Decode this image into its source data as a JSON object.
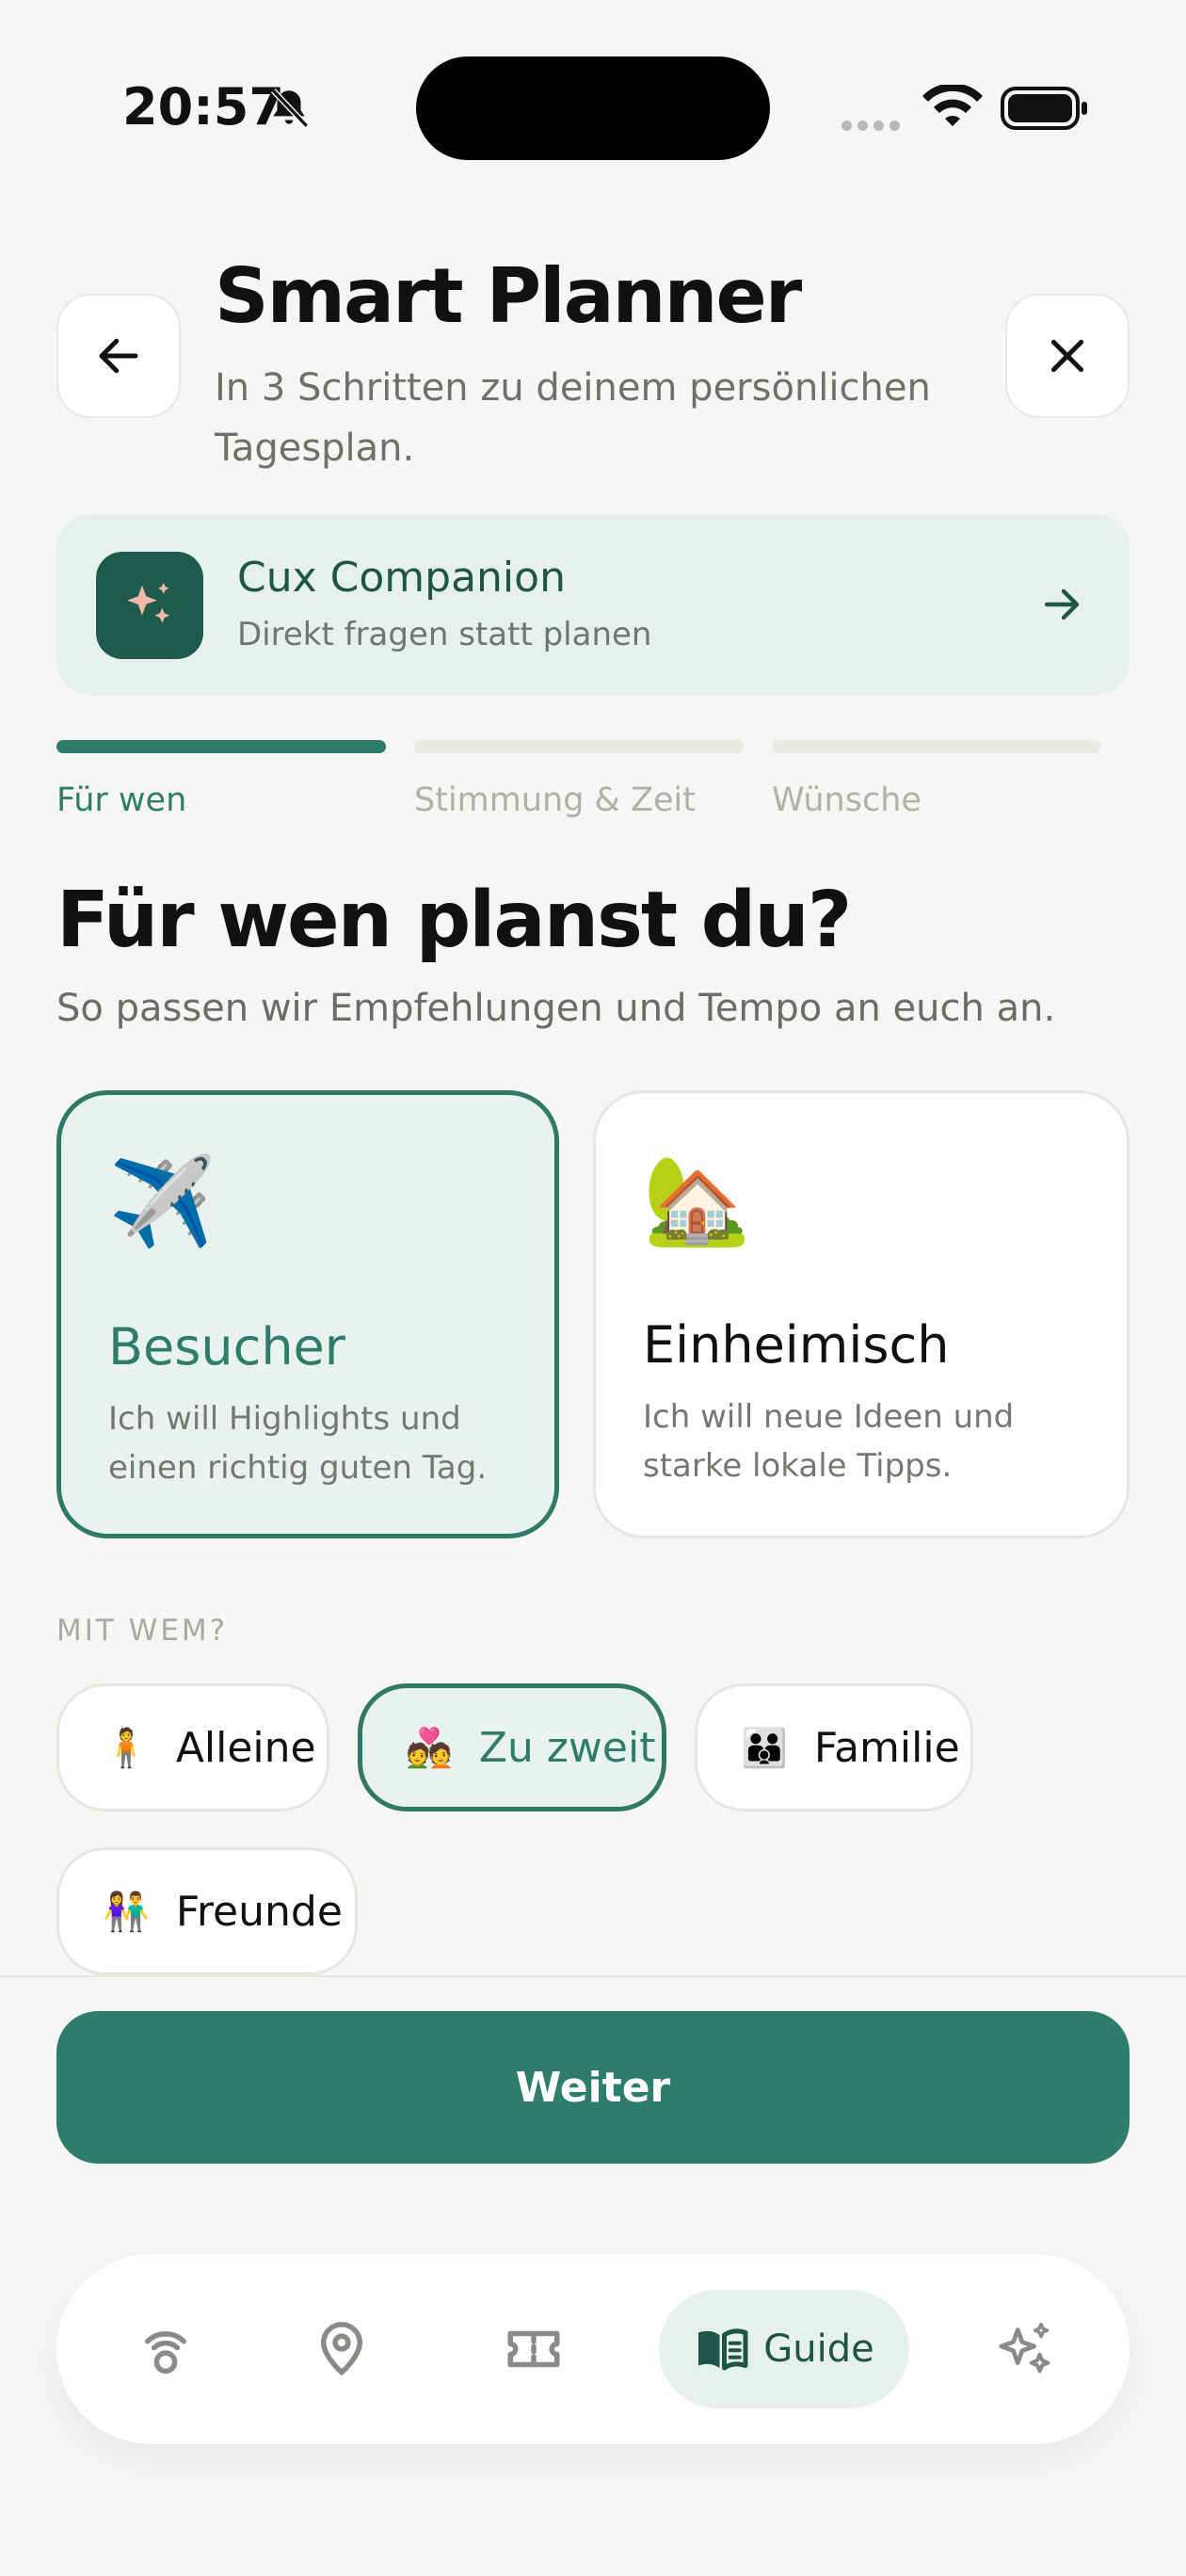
{
  "status_bar": {
    "time": "20:57"
  },
  "header": {
    "title": "Smart Planner",
    "subtitle": "In 3 Schritten zu deinem persönlichen Tagesplan."
  },
  "companion": {
    "title": "Cux Companion",
    "subtitle": "Direkt fragen statt planen",
    "icon": "sparkles-icon"
  },
  "steps": [
    {
      "label": "Für wen",
      "active": true
    },
    {
      "label": "Stimmung & Zeit",
      "active": false
    },
    {
      "label": "Wünsche",
      "active": false
    }
  ],
  "question": {
    "title": "Für wen planst du?",
    "subtitle": "So passen wir Empfehlungen und Tempo an euch an."
  },
  "audience_cards": [
    {
      "emoji": "✈️",
      "title": "Besucher",
      "description": "Ich will Highlights und einen richtig guten Tag.",
      "selected": true
    },
    {
      "emoji": "🏡",
      "title": "Einheimisch",
      "description": "Ich will neue Ideen und starke lokale Tipps.",
      "selected": false
    }
  ],
  "companions": {
    "label": "MIT WEM?",
    "options": [
      {
        "emoji": "🧍",
        "label": "Alleine",
        "selected": false
      },
      {
        "emoji": "💑",
        "label": "Zu zweit",
        "selected": true
      },
      {
        "emoji": "👪",
        "label": "Familie",
        "selected": false
      },
      {
        "emoji": "👫",
        "label": "Freunde",
        "selected": false
      }
    ]
  },
  "continue_button": "Weiter",
  "tab_bar": {
    "items": [
      {
        "icon": "audio-guide-icon"
      },
      {
        "icon": "map-pin-icon"
      },
      {
        "icon": "ticket-icon"
      },
      {
        "icon": "book-icon",
        "label": "Guide",
        "active": true
      },
      {
        "icon": "sparkles-icon"
      }
    ]
  },
  "colors": {
    "accent": "#2e7d6b",
    "accent_dark": "#1f5b4c",
    "accent_light": "#e6f0ec",
    "background": "#f6f6f4"
  }
}
